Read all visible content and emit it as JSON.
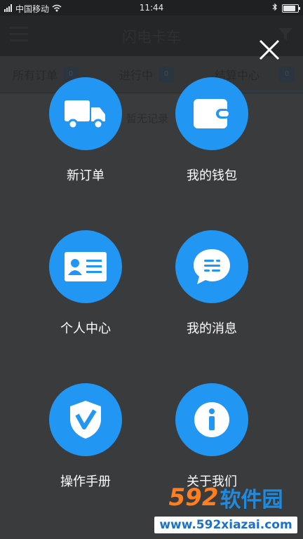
{
  "status_bar": {
    "carrier": "中国移动",
    "time": "11:44"
  },
  "background_app": {
    "title": "闪电卡车",
    "tabs": [
      {
        "label": "所有订单",
        "badge": "0"
      },
      {
        "label": "进行中",
        "badge": "0"
      },
      {
        "label": "结算中心",
        "badge": "0"
      }
    ],
    "empty_text": "暂无记录"
  },
  "menu": {
    "items": [
      {
        "label": "新订单",
        "icon": "truck-icon"
      },
      {
        "label": "我的钱包",
        "icon": "wallet-icon"
      },
      {
        "label": "个人中心",
        "icon": "id-card-icon"
      },
      {
        "label": "我的消息",
        "icon": "message-icon"
      },
      {
        "label": "操作手册",
        "icon": "shield-icon"
      },
      {
        "label": "关于我们",
        "icon": "info-icon"
      }
    ],
    "accent_color": "#2196f3"
  },
  "watermark": {
    "digits": "592",
    "brand": "软件园",
    "url": "www.592xiazai.com"
  }
}
